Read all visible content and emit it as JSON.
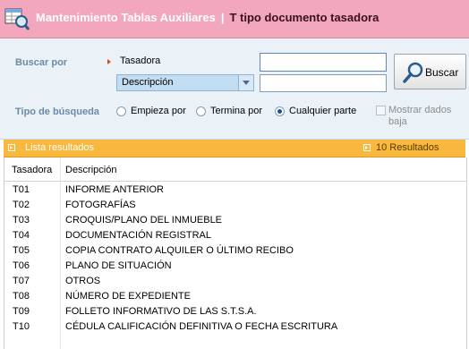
{
  "header": {
    "title": "Mantenimiento Tablas Auxiliares",
    "separator": "|",
    "subtitle": "T tipo documento tasadora"
  },
  "search": {
    "section_label": "Buscar por",
    "field1_label": "Tasadora",
    "field1_value": "",
    "field2_selected": "Descripción",
    "field2_value": "",
    "search_button": "Buscar",
    "type_label": "Tipo de búsqueda",
    "options": [
      "Empieza por",
      "Termina por",
      "Cualquier parte"
    ],
    "selected_option": "Cualquier parte",
    "show_deleted_label": "Mostrar dados baja",
    "show_deleted_checked": false
  },
  "results": {
    "title": "Lista resultados",
    "count_label": "10 Resultados",
    "columns": [
      "Tasadora",
      "Descripción"
    ],
    "rows": [
      [
        "T01",
        "INFORME ANTERIOR"
      ],
      [
        "T02",
        "FOTOGRAFÍAS"
      ],
      [
        "T03",
        "CROQUIS/PLANO DEL INMUEBLE"
      ],
      [
        "T04",
        "DOCUMENTACIÓN REGISTRAL"
      ],
      [
        "T05",
        "COPIA CONTRATO ALQUILER O ÚLTIMO RECIBO"
      ],
      [
        "T06",
        "PLANO DE SITUACIÓN"
      ],
      [
        "T07",
        "OTROS"
      ],
      [
        "T08",
        "NÚMERO DE EXPEDIENTE"
      ],
      [
        "T09",
        "FOLLETO INFORMATIVO DE LAS S.T.S.A."
      ],
      [
        "T10",
        "CÉDULA CALIFICACIÓN DEFINITIVA O FECHA ESCRITURA"
      ]
    ]
  },
  "colors": {
    "title_bar": "#f2a7bd",
    "search_panel": "#eaf2f8",
    "results_bar": "#f7b83d",
    "label_blue": "#6b8aa8"
  }
}
